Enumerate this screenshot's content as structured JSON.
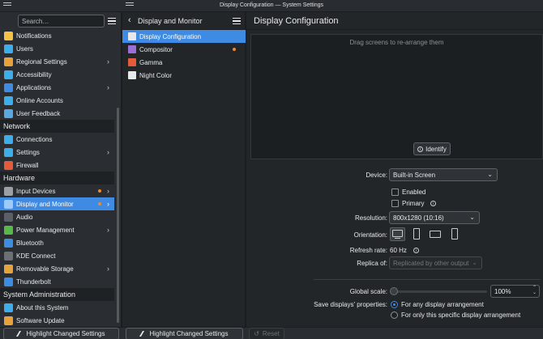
{
  "window": {
    "title": "Display Configuration — System Settings"
  },
  "sidebar": {
    "search_placeholder": "Search…",
    "items": [
      {
        "label": "Notifications",
        "icon": "bell-icon",
        "color": "#f6c344"
      },
      {
        "label": "Users",
        "icon": "users-icon",
        "color": "#3daee9"
      },
      {
        "label": "Regional Settings",
        "icon": "flag-icon",
        "color": "#e8a23d",
        "arrow": true
      },
      {
        "label": "Accessibility",
        "icon": "accessibility-icon",
        "color": "#3daee9"
      },
      {
        "label": "Applications",
        "icon": "apps-icon",
        "color": "#3f8ae2",
        "arrow": true
      },
      {
        "label": "Online Accounts",
        "icon": "online-accounts-icon",
        "color": "#3daee9"
      },
      {
        "label": "User Feedback",
        "icon": "feedback-icon",
        "color": "#5aa8e0"
      }
    ],
    "section_network": "Network",
    "network_items": [
      {
        "label": "Connections",
        "icon": "connections-icon",
        "color": "#3daee9"
      },
      {
        "label": "Settings",
        "icon": "network-settings-icon",
        "color": "#3daee9",
        "arrow": true
      },
      {
        "label": "Firewall",
        "icon": "firewall-icon",
        "color": "#e35b3a"
      }
    ],
    "section_hardware": "Hardware",
    "hardware_items": [
      {
        "label": "Input Devices",
        "icon": "input-devices-icon",
        "color": "#9aa0a6",
        "arrow": true,
        "dot": true
      },
      {
        "label": "Display and Monitor",
        "icon": "display-icon",
        "color": "#9ecbf5",
        "arrow": true,
        "dot": true,
        "active": true
      },
      {
        "label": "Audio",
        "icon": "audio-icon",
        "color": "#5b6066"
      },
      {
        "label": "Power Management",
        "icon": "power-icon",
        "color": "#58b947",
        "arrow": true
      },
      {
        "label": "Bluetooth",
        "icon": "bluetooth-icon",
        "color": "#3d8ee0"
      },
      {
        "label": "KDE Connect",
        "icon": "kde-connect-icon",
        "color": "#6c7075"
      },
      {
        "label": "Removable Storage",
        "icon": "removable-storage-icon",
        "color": "#e3a33d",
        "arrow": true
      },
      {
        "label": "Thunderbolt",
        "icon": "thunderbolt-icon",
        "color": "#3d8ee0"
      }
    ],
    "section_sysadmin": "System Administration",
    "sysadmin_items": [
      {
        "label": "About this System",
        "icon": "info-icon",
        "color": "#3daee9"
      },
      {
        "label": "Software Update",
        "icon": "software-update-icon",
        "color": "#e8a23d"
      }
    ]
  },
  "sublist": {
    "title": "Display and Monitor",
    "items": [
      {
        "label": "Display Configuration",
        "icon": "monitor-icon",
        "color": "#e6e8ea",
        "active": true
      },
      {
        "label": "Compositor",
        "icon": "compositor-icon",
        "color": "#9b6fd6",
        "dot": true
      },
      {
        "label": "Gamma",
        "icon": "gamma-icon",
        "color": "#e35b3a"
      },
      {
        "label": "Night Color",
        "icon": "night-color-icon",
        "color": "#e6e8ea"
      }
    ]
  },
  "main": {
    "title": "Display Configuration",
    "canvas_hint": "Drag screens to re-arrange them",
    "identify_label": "Identify",
    "device_label": "Device:",
    "device_value": "Built-in Screen",
    "enabled_label": "Enabled",
    "primary_label": "Primary",
    "resolution_label": "Resolution:",
    "resolution_value": "800x1280 (10:16)",
    "orientation_label": "Orientation:",
    "refresh_label": "Refresh rate:",
    "refresh_value": "60 Hz",
    "replica_label": "Replica of:",
    "replica_value": "Replicated by other output",
    "scale_label": "Global scale:",
    "scale_value": "100%",
    "scale_fraction": 0.0,
    "save_label": "Save displays' properties:",
    "save_opt1": "For any display arrangement",
    "save_opt2": "For only this specific display arrangement"
  },
  "bottom": {
    "highlight1": "Highlight Changed Settings",
    "highlight2": "Highlight Changed Settings",
    "reset": "Reset"
  },
  "colors": {
    "accent": "#3f8ae2",
    "notify_dot": "#f1872e"
  }
}
